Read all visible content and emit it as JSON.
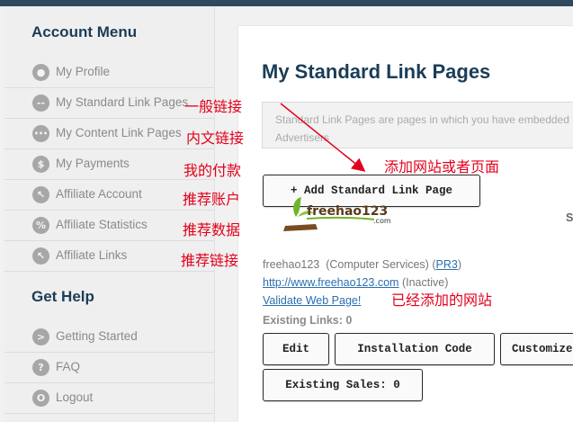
{
  "sidebar": {
    "account_title": "Account Menu",
    "items": [
      {
        "label": "My Profile",
        "icon": "user-icon",
        "glyph": "●"
      },
      {
        "label": "My Standard Link Pages",
        "icon": "link-icon",
        "glyph": "--"
      },
      {
        "label": "My Content Link Pages",
        "icon": "dots-icon",
        "glyph": "•••"
      },
      {
        "label": "My Payments",
        "icon": "dollar-icon",
        "glyph": "$"
      },
      {
        "label": "Affiliate Account",
        "icon": "cursor-icon",
        "glyph": "↖"
      },
      {
        "label": "Affiliate Statistics",
        "icon": "percent-icon",
        "glyph": "%"
      },
      {
        "label": "Affiliate Links",
        "icon": "cursor-icon",
        "glyph": "↖"
      }
    ],
    "help_title": "Get Help",
    "help_items": [
      {
        "label": "Getting Started",
        "icon": "chevron-right-icon",
        "glyph": ">"
      },
      {
        "label": "FAQ",
        "icon": "question-icon",
        "glyph": "?"
      },
      {
        "label": "Logout",
        "icon": "power-icon",
        "glyph": "O"
      }
    ]
  },
  "annotations": {
    "standard_link_pages": "一般链接",
    "content_link_pages": "内文链接",
    "payments": "我的付款",
    "affiliate_account": "推荐账户",
    "affiliate_statistics": "推荐数据",
    "affiliate_links": "推荐链接",
    "add_site": "添加网站或者页面",
    "added_site": "已经添加的网站"
  },
  "main": {
    "title": "My Standard Link Pages",
    "info_text": "Standard Link Pages are pages in which you have embedded Advertisers",
    "add_button": "+ Add Standard Link Page",
    "logo_text": "freehao123",
    "logo_suffix": ".com",
    "edge_letter": "S",
    "site": {
      "name": "freehao123",
      "category": "(Computer Services)",
      "pr_open": "(",
      "pr": "PR3",
      "pr_close": ")",
      "url": "http://www.freehao123.com",
      "status": "(Inactive)",
      "validate": "Validate Web Page!",
      "existing_links_label": "Existing Links:",
      "existing_links_value": "0"
    },
    "buttons": {
      "edit": "Edit",
      "install": "Installation Code",
      "customize": "Customize",
      "existing_sales": "Existing Sales: 0"
    }
  },
  "colors": {
    "accent": "#1b3d57",
    "annotation": "#e3001b",
    "link": "#2a6fb0"
  }
}
